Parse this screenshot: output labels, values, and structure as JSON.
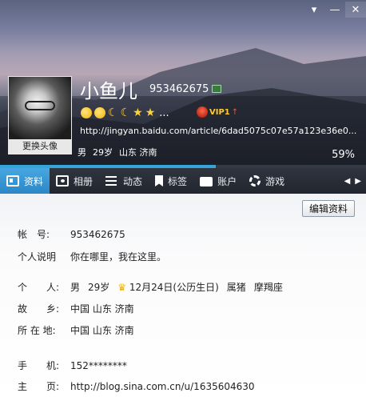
{
  "header": {
    "nickname": "小鱼儿",
    "qq_number": "953462675",
    "change_avatar": "更换头像",
    "more_dots": "...",
    "vip_label": "VIP1",
    "vip_arrow": "↑",
    "url": "http://jingyan.baidu.com/article/6dad5075c07e57a123e36e0...",
    "gender": "男",
    "age": "29岁",
    "location": "山东 济南",
    "completion_percent": "59%",
    "completion_value": 0.59,
    "controls": {
      "skin": "▾",
      "minimize": "—",
      "close": "✕"
    }
  },
  "tabs": [
    {
      "label": "资料",
      "icon": "card-icon",
      "active": true
    },
    {
      "label": "相册",
      "icon": "photo-icon",
      "active": false
    },
    {
      "label": "动态",
      "icon": "list-icon",
      "active": false
    },
    {
      "label": "标签",
      "icon": "bookmark-icon",
      "active": false
    },
    {
      "label": "账户",
      "icon": "bag-icon",
      "active": false
    },
    {
      "label": "游戏",
      "icon": "gear-icon",
      "active": false
    }
  ],
  "tab_nav": {
    "prev": "◀",
    "next": "▶"
  },
  "content": {
    "edit_button": "编辑资料",
    "account": {
      "label": "帐　号:",
      "value": "953462675"
    },
    "signature": {
      "label": "个人说明",
      "value": "你在哪里，我在这里。"
    },
    "personal": {
      "label": "个　　人:",
      "gender": "男",
      "age": "29岁",
      "birthday": "12月24日(公历生日)",
      "zodiac": "属猪",
      "constellation": "摩羯座"
    },
    "hometown": {
      "label": "故　　乡:",
      "value": "中国 山东 济南"
    },
    "residence": {
      "label": "所 在 地:",
      "value": "中国 山东 济南"
    },
    "mobile": {
      "label": "手　　机:",
      "value": "152********"
    },
    "homepage": {
      "label": "主　　页:",
      "value": "http://blog.sina.com.cn/u/1635604630"
    }
  }
}
